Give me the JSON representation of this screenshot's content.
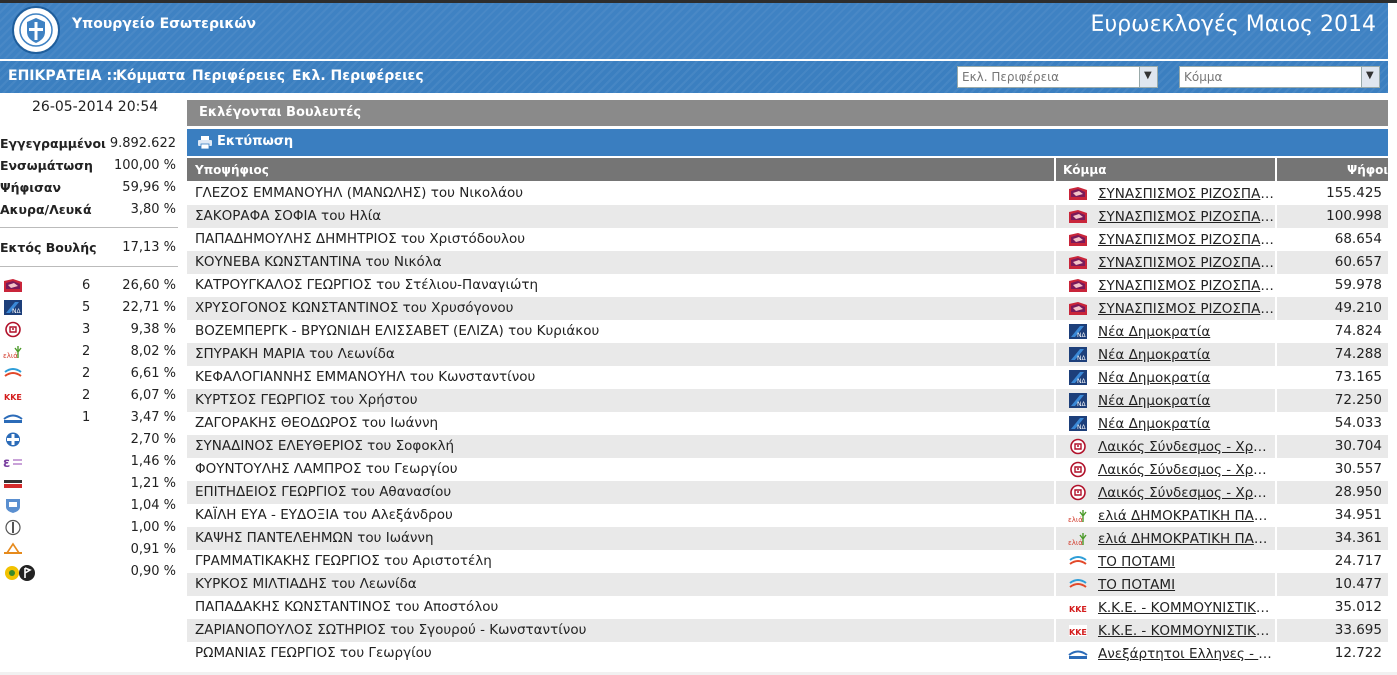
{
  "header": {
    "ministry": "Υπουργείο Εσωτερικών",
    "title": "Ευρωεκλογές Μαιος 2014",
    "accent": "#3f82c3"
  },
  "nav": {
    "epikrateia": "ΕΠΙΚΡΑΤΕΙΑ ::",
    "parties": "Κόμματα",
    "regions": "Περιφέρειες",
    "constituencies": "Εκλ. Περιφέρειες",
    "select_constituency": "Εκλ. Περιφέρεια",
    "select_party": "Κόμμα"
  },
  "sidebar": {
    "datetime": "26-05-2014 20:54",
    "stats": [
      {
        "label": "Εγγεγραμμένοι",
        "value": "9.892.622"
      },
      {
        "label": "Ενσωμάτωση",
        "value": "100,00 %"
      },
      {
        "label": "Ψήφισαν",
        "value": "59,96 %"
      },
      {
        "label": "Ακυρα/Λευκά",
        "value": "3,80 %"
      }
    ],
    "outside": {
      "label": "Εκτός Βουλής",
      "value": "17,13 %"
    },
    "parties": [
      {
        "logo": "syriza-logo",
        "seats": "6",
        "pct": "26,60 %"
      },
      {
        "logo": "nd-logo",
        "seats": "5",
        "pct": "22,71 %"
      },
      {
        "logo": "xa-logo",
        "seats": "3",
        "pct": "9,38 %"
      },
      {
        "logo": "elia-logo",
        "seats": "2",
        "pct": "8,02 %"
      },
      {
        "logo": "potami-logo",
        "seats": "2",
        "pct": "6,61 %"
      },
      {
        "logo": "kke-logo",
        "seats": "2",
        "pct": "6,07 %"
      },
      {
        "logo": "anel-logo",
        "seats": "1",
        "pct": "3,47 %"
      },
      {
        "logo": "laos-logo",
        "seats": "",
        "pct": "2,70 %"
      },
      {
        "logo": "ep-logo",
        "seats": "",
        "pct": "1,46 %"
      },
      {
        "logo": "dimar-logo",
        "seats": "",
        "pct": "1,21 %"
      },
      {
        "logo": "party-11-logo",
        "seats": "",
        "pct": "1,04 %"
      },
      {
        "logo": "party-12-logo",
        "seats": "",
        "pct": "1,00 %"
      },
      {
        "logo": "party-13-logo",
        "seats": "",
        "pct": "0,91 %"
      },
      {
        "logo": "greens-pirates-logo",
        "seats": "",
        "pct": "0,90 %"
      }
    ]
  },
  "main": {
    "elected_title": "Εκλέγονται Βουλευτές",
    "print_label": "Εκτύπωση",
    "columns": {
      "candidate": "Υποψήφιος",
      "party": "Κόμμα",
      "votes": "Ψήφοι"
    },
    "rows": [
      {
        "candidate": "ΓΛΕΖΟΣ ΕΜΜΑΝΟΥΗΛ (ΜΑΝΩΛΗΣ) του Νικολάου",
        "logo": "syriza-logo",
        "party": "ΣΥΝΑΣΠΙΣΜΟΣ ΡΙΖΟΣΠΑΣΤΙΚΗΣ ΑΡΙΣΤΕΡΑΣ",
        "votes": "155.425"
      },
      {
        "candidate": "ΣΑΚΟΡΑΦΑ ΣΟΦΙΑ του Ηλία",
        "logo": "syriza-logo",
        "party": "ΣΥΝΑΣΠΙΣΜΟΣ ΡΙΖΟΣΠΑΣΤΙΚΗΣ ΑΡΙΣΤΕΡΑΣ",
        "votes": "100.998"
      },
      {
        "candidate": "ΠΑΠΑΔΗΜΟΥΛΗΣ ΔΗΜΗΤΡΙΟΣ του Χριστόδουλου",
        "logo": "syriza-logo",
        "party": "ΣΥΝΑΣΠΙΣΜΟΣ ΡΙΖΟΣΠΑΣΤΙΚΗΣ ΑΡΙΣΤΕΡΑΣ",
        "votes": "68.654"
      },
      {
        "candidate": "ΚΟΥΝΕΒΑ ΚΩΝΣΤΑΝΤΙΝΑ του Νικόλα",
        "logo": "syriza-logo",
        "party": "ΣΥΝΑΣΠΙΣΜΟΣ ΡΙΖΟΣΠΑΣΤΙΚΗΣ ΑΡΙΣΤΕΡΑΣ",
        "votes": "60.657"
      },
      {
        "candidate": "ΚΑΤΡΟΥΓΚΑΛΟΣ ΓΕΩΡΓΙΟΣ του Στέλιου-Παναγιώτη",
        "logo": "syriza-logo",
        "party": "ΣΥΝΑΣΠΙΣΜΟΣ ΡΙΖΟΣΠΑΣΤΙΚΗΣ ΑΡΙΣΤΕΡΑΣ",
        "votes": "59.978"
      },
      {
        "candidate": "ΧΡΥΣΟΓΟΝΟΣ ΚΩΝΣΤΑΝΤΙΝΟΣ του Χρυσόγονου",
        "logo": "syriza-logo",
        "party": "ΣΥΝΑΣΠΙΣΜΟΣ ΡΙΖΟΣΠΑΣΤΙΚΗΣ ΑΡΙΣΤΕΡΑΣ",
        "votes": "49.210"
      },
      {
        "candidate": "ΒΟΖΕΜΠΕΡΓΚ - ΒΡΥΩΝΙΔΗ ΕΛΙΣΣΑΒΕΤ (ΕΛΙΖΑ) του Κυριάκου",
        "logo": "nd-logo",
        "party": "Νέα Δημοκρατία",
        "votes": "74.824"
      },
      {
        "candidate": "ΣΠΥΡΑΚΗ ΜΑΡΙΑ του Λεωνίδα",
        "logo": "nd-logo",
        "party": "Νέα Δημοκρατία",
        "votes": "74.288"
      },
      {
        "candidate": "ΚΕΦΑΛΟΓΙΑΝΝΗΣ ΕΜΜΑΝΟΥΗΛ του Κωνσταντίνου",
        "logo": "nd-logo",
        "party": "Νέα Δημοκρατία",
        "votes": "73.165"
      },
      {
        "candidate": "ΚΥΡΤΣΟΣ ΓΕΩΡΓΙΟΣ του Χρήστου",
        "logo": "nd-logo",
        "party": "Νέα Δημοκρατία",
        "votes": "72.250"
      },
      {
        "candidate": "ΖΑΓΟΡΑΚΗΣ ΘΕΟΔΩΡΟΣ του Ιωάννη",
        "logo": "nd-logo",
        "party": "Νέα Δημοκρατία",
        "votes": "54.033"
      },
      {
        "candidate": "ΣΥΝΑΔΙΝΟΣ ΕΛΕΥΘΕΡΙΟΣ του Σοφοκλή",
        "logo": "xa-logo",
        "party": "Λαικός Σύνδεσμος - Χρυσή Αυγή",
        "votes": "30.704"
      },
      {
        "candidate": "ΦΟΥΝΤΟΥΛΗΣ ΛΑΜΠΡΟΣ του Γεωργίου",
        "logo": "xa-logo",
        "party": "Λαικός Σύνδεσμος - Χρυσή Αυγή",
        "votes": "30.557"
      },
      {
        "candidate": "ΕΠΙΤΗΔΕΙΟΣ ΓΕΩΡΓΙΟΣ του Αθανασίου",
        "logo": "xa-logo",
        "party": "Λαικός Σύνδεσμος - Χρυσή Αυγή",
        "votes": "28.950"
      },
      {
        "candidate": "ΚΑΪΛΗ ΕΥΑ - ΕΥΔΟΞΙΑ του Αλεξάνδρου",
        "logo": "elia-logo",
        "party": "ελιά ΔΗΜΟΚΡΑΤΙΚΗ ΠΑΡΑΤΑΞΗ",
        "votes": "34.951"
      },
      {
        "candidate": "ΚΑΨΗΣ ΠΑΝΤΕΛΕΗΜΩΝ του Ιωάννη",
        "logo": "elia-logo",
        "party": "ελιά ΔΗΜΟΚΡΑΤΙΚΗ ΠΑΡΑΤΑΞΗ",
        "votes": "34.361"
      },
      {
        "candidate": "ΓΡΑΜΜΑΤΙΚΑΚΗΣ ΓΕΩΡΓΙΟΣ του Αριστοτέλη",
        "logo": "potami-logo",
        "party": "ΤΟ ΠΟΤΑΜΙ",
        "votes": "24.717"
      },
      {
        "candidate": "ΚΥΡΚΟΣ ΜΙΛΤΙΑΔΗΣ του Λεωνίδα",
        "logo": "potami-logo",
        "party": "ΤΟ ΠΟΤΑΜΙ",
        "votes": "10.477"
      },
      {
        "candidate": "ΠΑΠΑΔΑΚΗΣ ΚΩΝΣΤΑΝΤΙΝΟΣ του Αποστόλου",
        "logo": "kke-logo",
        "party": "Κ.Κ.Ε. - ΚΟΜΜΟΥΝΙΣΤΙΚΟ ΚΟΜΜΑ",
        "votes": "35.012"
      },
      {
        "candidate": "ΖΑΡΙΑΝΟΠΟΥΛΟΣ ΣΩΤΗΡΙΟΣ του Σγουρού - Κωνσταντίνου",
        "logo": "kke-logo",
        "party": "Κ.Κ.Ε. - ΚΟΜΜΟΥΝΙΣΤΙΚΟ ΚΟΜΜΑ",
        "votes": "33.695"
      },
      {
        "candidate": "ΡΩΜΑΝΙΑΣ ΓΕΩΡΓΙΟΣ του Γεωργίου",
        "logo": "anel-logo",
        "party": "Ανεξάρτητοι Ελληνες - Πάνος Καμμένος",
        "votes": "12.722"
      }
    ]
  }
}
